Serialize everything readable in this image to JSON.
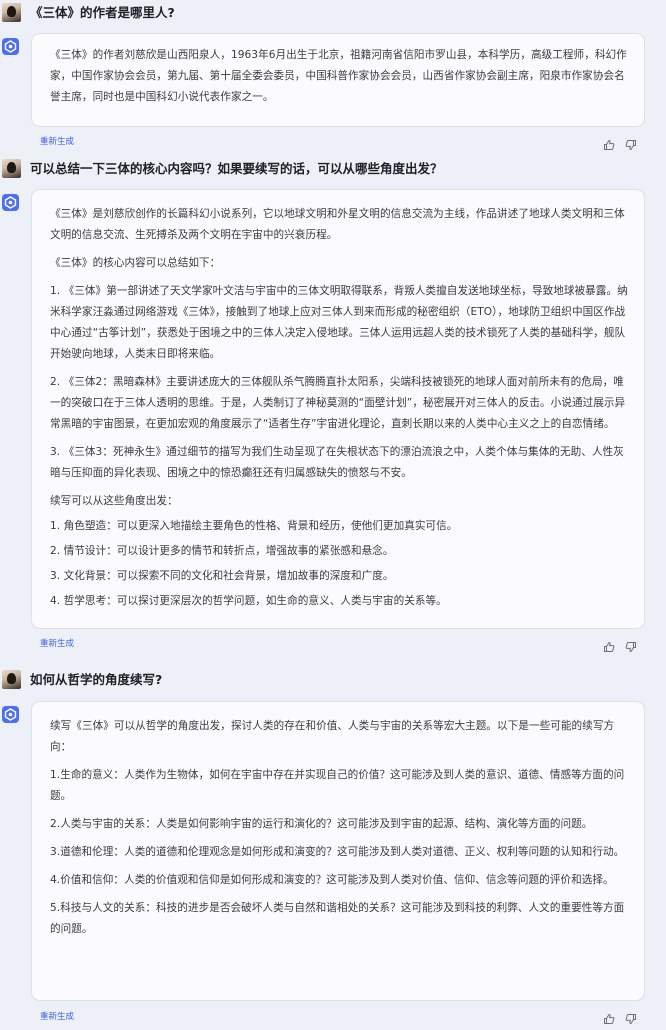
{
  "colors": {
    "accent": "#4e6ef2",
    "link": "#3d62e6",
    "background": "#eef0f7",
    "card": "#fbfbfd"
  },
  "regen_label": "重新生成",
  "icons": {
    "user": "user-avatar",
    "bot": "bot-logo-icon",
    "like": "thumbs-up-icon",
    "dislike": "thumbs-down-icon"
  },
  "conversation": [
    {
      "question": "《三体》的作者是哪里人?",
      "answer": [
        "《三体》的作者刘慈欣是山西阳泉人，1963年6月出生于北京，祖籍河南省信阳市罗山县，本科学历，高级工程师，科幻作家，中国作家协会会员，第九届、第十届全委会委员，中国科普作家协会会员，山西省作家协会副主席，阳泉市作家协会名誉主席，同时也是中国科幻小说代表作家之一。"
      ]
    },
    {
      "question": "可以总结一下三体的核心内容吗？如果要续写的话，可以从哪些角度出发？",
      "answer": [
        "《三体》是刘慈欣创作的长篇科幻小说系列，它以地球文明和外星文明的信息交流为主线，作品讲述了地球人类文明和三体文明的信息交流、生死搏杀及两个文明在宇宙中的兴衰历程。",
        "《三体》的核心内容可以总结如下：",
        "1. 《三体》第一部讲述了天文学家叶文洁与宇宙中的三体文明取得联系，背叛人类擅自发送地球坐标，导致地球被暴露。纳米科学家汪淼通过网络游戏《三体》，接触到了地球上应对三体人到来而形成的秘密组织（ETO），地球防卫组织中国区作战中心通过“古筝计划”，获悉处于困境之中的三体人决定入侵地球。三体人运用远超人类的技术锁死了人类的基础科学，舰队开始驶向地球，人类末日即将来临。",
        "2. 《三体2：黑暗森林》主要讲述庞大的三体舰队杀气腾腾直扑太阳系，尖端科技被锁死的地球人面对前所未有的危局，唯一的突破口在于三体人透明的思维。于是，人类制订了神秘莫测的“面壁计划”，秘密展开对三体人的反击。小说通过展示异常黑暗的宇宙图景，在更加宏观的角度展示了“适者生存”宇宙进化理论，直刺长期以来的人类中心主义之上的自恋情绪。",
        "3. 《三体3：死神永生》通过细节的描写为我们生动呈现了在失根状态下的漂泊流浪之中，人类个体与集体的无助、人性灰暗与压抑面的异化表现、困境之中的惊恐癫狂还有归属感缺失的愤怒与不安。",
        "续写可以从这些角度出发：",
        "1. 角色塑造：可以更深入地描绘主要角色的性格、背景和经历，使他们更加真实可信。",
        "2. 情节设计：可以设计更多的情节和转折点，增强故事的紧张感和悬念。",
        "3. 文化背景：可以探索不同的文化和社会背景，增加故事的深度和广度。",
        "4. 哲学思考：可以探讨更深层次的哲学问题，如生命的意义、人类与宇宙的关系等。"
      ]
    },
    {
      "question": "如何从哲学的角度续写?",
      "answer": [
        "续写《三体》可以从哲学的角度出发，探讨人类的存在和价值、人类与宇宙的关系等宏大主题。以下是一些可能的续写方向：",
        "1.生命的意义：人类作为生物体，如何在宇宙中存在并实现自己的价值？这可能涉及到人类的意识、道德、情感等方面的问题。",
        "2.人类与宇宙的关系：人类是如何影响宇宙的运行和演化的？这可能涉及到宇宙的起源、结构、演化等方面的问题。",
        "3.道德和伦理：人类的道德和伦理观念是如何形成和演变的？这可能涉及到人类对道德、正义、权利等问题的认知和行动。",
        "4.价值和信仰：人类的价值观和信仰是如何形成和演变的？这可能涉及到人类对价值、信仰、信念等问题的评价和选择。",
        "5.科技与人文的关系：科技的进步是否会破坏人类与自然和谐相处的关系？这可能涉及到科技的利弊、人文的重要性等方面的问题。"
      ]
    }
  ]
}
